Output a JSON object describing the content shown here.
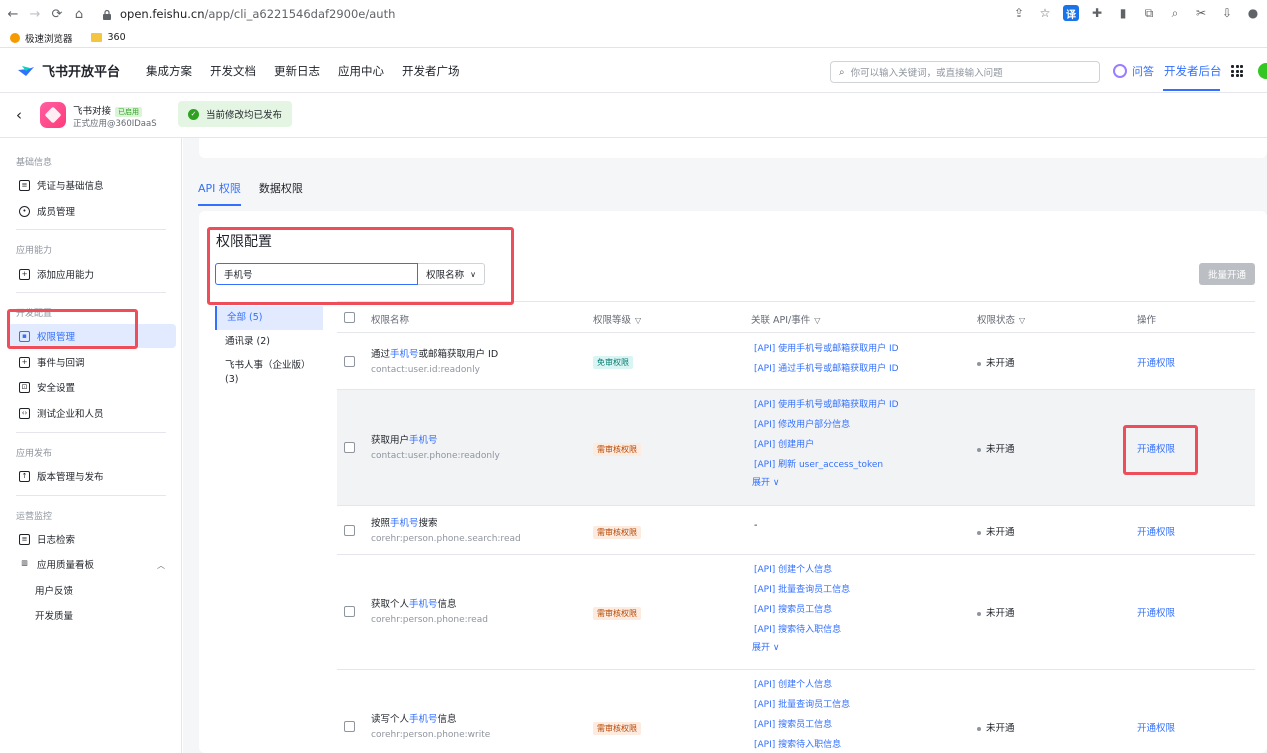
{
  "browser": {
    "url_host": "open.feishu.cn",
    "url_path": "/app/cli_a6221546daf2900e/auth",
    "translate_label": "译",
    "bookmarks": [
      {
        "label": "极速浏览器"
      },
      {
        "label": "360"
      }
    ]
  },
  "header": {
    "logo_text": "飞书开放平台",
    "nav": [
      "集成方案",
      "开发文档",
      "更新日志",
      "应用中心",
      "开发者广场"
    ],
    "search_placeholder": "你可以输入关键词，或直接输入问题",
    "ask_label": "问答",
    "dev_console_label": "开发者后台"
  },
  "app": {
    "name": "飞书对接",
    "badge": "已启用",
    "desc": "正式应用@360IDaaS",
    "publish_tip": "当前修改均已发布"
  },
  "sidebar": {
    "groups": [
      {
        "title": "基础信息",
        "items": [
          {
            "label": "凭证与基础信息",
            "icon": "id-card-icon"
          },
          {
            "label": "成员管理",
            "icon": "user-icon"
          }
        ]
      },
      {
        "title": "应用能力",
        "items": [
          {
            "label": "添加应用能力",
            "icon": "grid-plus-icon"
          }
        ]
      },
      {
        "title": "开发配置",
        "items": [
          {
            "label": "权限管理",
            "icon": "lock-icon",
            "active": true
          },
          {
            "label": "事件与回调",
            "icon": "event-icon"
          },
          {
            "label": "安全设置",
            "icon": "shield-icon"
          },
          {
            "label": "测试企业和人员",
            "icon": "code-icon"
          }
        ]
      },
      {
        "title": "应用发布",
        "items": [
          {
            "label": "版本管理与发布",
            "icon": "upload-icon"
          }
        ]
      },
      {
        "title": "运营监控",
        "items": [
          {
            "label": "日志检索",
            "icon": "log-icon"
          },
          {
            "label": "应用质量看板",
            "icon": "chart-icon"
          },
          {
            "label": "用户反馈",
            "sub": true
          },
          {
            "label": "开发质量",
            "sub": true
          }
        ]
      }
    ]
  },
  "main": {
    "tabs": [
      "API 权限",
      "数据权限"
    ],
    "section_title": "权限配置",
    "filter_value": "手机号",
    "filter_select": "权限名称",
    "batch_label": "批量开通",
    "categories": [
      "全部 (5)",
      "通讯录 (2)",
      "飞书人事（企业版）(3)"
    ],
    "columns": [
      "权限名称",
      "权限等级",
      "关联 API/事件",
      "权限状态",
      "操作"
    ],
    "rows": [
      {
        "name_pre": "通过",
        "name_hl": "手机号",
        "name_post": "或邮箱获取用户 ID",
        "code": "contact:user.id:readonly",
        "level": "免审权限",
        "level_type": "free",
        "apis": [
          "[API] 使用手机号或邮箱获取用户 ID",
          "[API] 通过手机号或邮箱获取用户 ID"
        ],
        "expand": "",
        "status": "未开通",
        "op": "开通权限"
      },
      {
        "name_pre": "获取用户",
        "name_hl": "手机号",
        "name_post": "",
        "code": "contact:user.phone:readonly",
        "level": "需审核权限",
        "level_type": "review",
        "apis": [
          "[API] 使用手机号或邮箱获取用户 ID",
          "[API] 修改用户部分信息",
          "[API] 创建用户",
          "[API] 刷新 user_access_token"
        ],
        "expand": "展开",
        "status": "未开通",
        "op": "开通权限"
      },
      {
        "name_pre": "按照",
        "name_hl": "手机号",
        "name_post": "搜索",
        "code": "corehr:person.phone.search:read",
        "level": "需审核权限",
        "level_type": "review",
        "apis": [
          "-"
        ],
        "expand": "",
        "status": "未开通",
        "op": "开通权限"
      },
      {
        "name_pre": "获取个人",
        "name_hl": "手机号",
        "name_post": "信息",
        "code": "corehr:person.phone:read",
        "level": "需审核权限",
        "level_type": "review",
        "apis": [
          "[API] 创建个人信息",
          "[API] 批量查询员工信息",
          "[API] 搜索员工信息",
          "[API] 搜索待入职信息"
        ],
        "expand": "展开",
        "status": "未开通",
        "op": "开通权限"
      },
      {
        "name_pre": "读写个人",
        "name_hl": "手机号",
        "name_post": "信息",
        "code": "corehr:person.phone:write",
        "level": "需审核权限",
        "level_type": "review",
        "apis": [
          "[API] 创建个人信息",
          "[API] 批量查询员工信息",
          "[API] 搜索员工信息",
          "[API] 搜索待入职信息"
        ],
        "expand": "",
        "status": "未开通",
        "op": "开通权限"
      }
    ]
  },
  "colors": {
    "accent": "#3370ff",
    "annotation": "#ee4d5a",
    "active_bg": "#e1eaff"
  }
}
